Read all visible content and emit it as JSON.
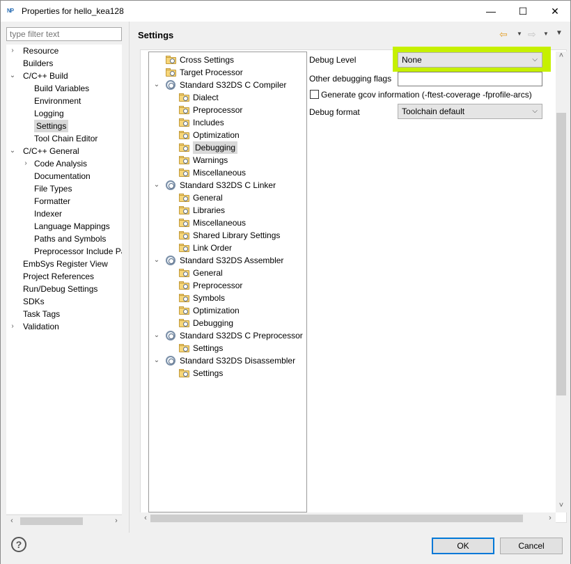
{
  "window": {
    "title": "Properties for hello_kea128",
    "icon_text": "NP",
    "minimize": "—",
    "maximize": "☐",
    "close": "✕"
  },
  "filter": {
    "placeholder": "type filter text"
  },
  "left_tree": [
    {
      "label": "Resource",
      "toggle": "›"
    },
    {
      "label": "Builders",
      "toggle": ""
    },
    {
      "label": "C/C++ Build",
      "toggle": "⌄"
    },
    {
      "label": "Build Variables",
      "toggle": ""
    },
    {
      "label": "Environment",
      "toggle": ""
    },
    {
      "label": "Logging",
      "toggle": ""
    },
    {
      "label": "Settings",
      "toggle": ""
    },
    {
      "label": "Tool Chain Editor",
      "toggle": ""
    },
    {
      "label": "C/C++ General",
      "toggle": "⌄"
    },
    {
      "label": "Code Analysis",
      "toggle": "›"
    },
    {
      "label": "Documentation",
      "toggle": ""
    },
    {
      "label": "File Types",
      "toggle": ""
    },
    {
      "label": "Formatter",
      "toggle": ""
    },
    {
      "label": "Indexer",
      "toggle": ""
    },
    {
      "label": "Language Mappings",
      "toggle": ""
    },
    {
      "label": "Paths and Symbols",
      "toggle": ""
    },
    {
      "label": "Preprocessor Include Pa",
      "toggle": ""
    },
    {
      "label": "EmbSys Register View",
      "toggle": ""
    },
    {
      "label": "Project References",
      "toggle": ""
    },
    {
      "label": "Run/Debug Settings",
      "toggle": ""
    },
    {
      "label": "SDKs",
      "toggle": ""
    },
    {
      "label": "Task Tags",
      "toggle": ""
    },
    {
      "label": "Validation",
      "toggle": "›"
    }
  ],
  "page_title": "Settings",
  "tool_tree": [
    {
      "label": "Cross Settings",
      "toggle": ""
    },
    {
      "label": "Target Processor",
      "toggle": ""
    },
    {
      "label": "Standard S32DS C Compiler",
      "toggle": "⌄"
    },
    {
      "label": "Dialect",
      "toggle": ""
    },
    {
      "label": "Preprocessor",
      "toggle": ""
    },
    {
      "label": "Includes",
      "toggle": ""
    },
    {
      "label": "Optimization",
      "toggle": ""
    },
    {
      "label": "Debugging",
      "toggle": ""
    },
    {
      "label": "Warnings",
      "toggle": ""
    },
    {
      "label": "Miscellaneous",
      "toggle": ""
    },
    {
      "label": "Standard S32DS C Linker",
      "toggle": "⌄"
    },
    {
      "label": "General",
      "toggle": ""
    },
    {
      "label": "Libraries",
      "toggle": ""
    },
    {
      "label": "Miscellaneous",
      "toggle": ""
    },
    {
      "label": "Shared Library Settings",
      "toggle": ""
    },
    {
      "label": "Link Order",
      "toggle": ""
    },
    {
      "label": "Standard S32DS Assembler",
      "toggle": "⌄"
    },
    {
      "label": "General",
      "toggle": ""
    },
    {
      "label": "Preprocessor",
      "toggle": ""
    },
    {
      "label": "Symbols",
      "toggle": ""
    },
    {
      "label": "Optimization",
      "toggle": ""
    },
    {
      "label": "Debugging",
      "toggle": ""
    },
    {
      "label": "Standard S32DS C Preprocessor",
      "toggle": "⌄"
    },
    {
      "label": "Settings",
      "toggle": ""
    },
    {
      "label": "Standard S32DS Disassembler",
      "toggle": "⌄"
    },
    {
      "label": "Settings",
      "toggle": ""
    }
  ],
  "options": {
    "debug_level_label": "Debug Level",
    "debug_level_value": "None",
    "other_flags_label": "Other debugging flags",
    "other_flags_value": "",
    "gcov_label": "Generate gcov information (-ftest-coverage -fprofile-arcs)",
    "debug_format_label": "Debug format",
    "debug_format_value": "Toolchain default"
  },
  "buttons": {
    "ok": "OK",
    "cancel": "Cancel",
    "help": "?"
  },
  "colors": {
    "highlight": "#c6f000",
    "accent": "#0078d7",
    "selection": "#d9d9d9"
  }
}
